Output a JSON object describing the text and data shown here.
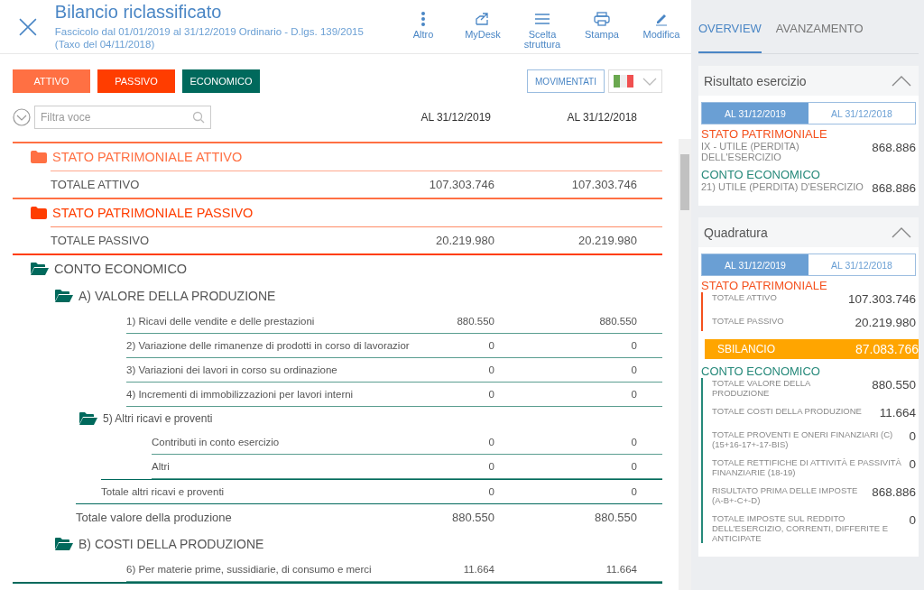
{
  "header": {
    "title": "Bilancio riclassificato",
    "subtitle": "Fascicolo dal 01/01/2019 al 31/12/2019 Ordinario - D.lgs. 139/2015 (Taxo del 04/11/2018)",
    "actions": [
      {
        "kind": "more",
        "label": "Altro"
      },
      {
        "kind": "desk",
        "label": "MyDesk"
      },
      {
        "kind": "structure",
        "label": "Scelta struttura"
      },
      {
        "kind": "print",
        "label": "Stampa"
      },
      {
        "kind": "edit",
        "label": "Modifica"
      }
    ]
  },
  "section_tabs": [
    {
      "label": "ATTIVO",
      "color": "#ff7043"
    },
    {
      "label": "PASSIVO",
      "color": "#ff3d00"
    },
    {
      "label": "ECONOMICO",
      "color": "#00695c"
    }
  ],
  "movimentati": "MOVIMENTATI",
  "filter": {
    "placeholder": "Filtra voce"
  },
  "columns": [
    "AL 31/12/2019",
    "AL 31/12/2018"
  ],
  "tree": [
    {
      "kind": "section",
      "label": "STATO PATRIMONIALE ATTIVO",
      "color": "#ff7043",
      "total": {
        "label": "TOTALE ATTIVO",
        "values": [
          "107.303.746",
          "107.303.746"
        ]
      }
    },
    {
      "kind": "section",
      "label": "STATO PATRIMONIALE PASSIVO",
      "color": "#ff3d00",
      "total": {
        "label": "TOTALE PASSIVO",
        "values": [
          "20.219.980",
          "20.219.980"
        ]
      }
    },
    {
      "kind": "group",
      "label": "CONTO ECONOMICO",
      "color": "#00695c",
      "children": [
        {
          "kind": "group",
          "label": "A) VALORE DELLA PRODUZIONE",
          "children": [
            {
              "kind": "row",
              "label": "1) Ricavi delle vendite e delle prestazioni",
              "values": [
                "880.550",
                "880.550"
              ]
            },
            {
              "kind": "row",
              "label": "2) Variazione delle rimanenze di prodotti in corso di lavorazior",
              "values": [
                "0",
                "0"
              ]
            },
            {
              "kind": "row",
              "label": "3) Variazioni dei lavori in corso su ordinazione",
              "values": [
                "0",
                "0"
              ]
            },
            {
              "kind": "row",
              "label": "4) Incrementi di immobilizzazioni per lavori interni",
              "values": [
                "0",
                "0"
              ]
            },
            {
              "kind": "group",
              "label": "5) Altri ricavi e proventi",
              "children": [
                {
                  "kind": "row",
                  "label": "Contributi in conto esercizio",
                  "values": [
                    "0",
                    "0"
                  ]
                },
                {
                  "kind": "row",
                  "label": "Altri",
                  "values": [
                    "0",
                    "0"
                  ]
                }
              ],
              "total": {
                "label": "Totale altri ricavi e proventi",
                "values": [
                  "0",
                  "0"
                ]
              }
            }
          ],
          "total": {
            "label": "Totale valore della produzione",
            "values": [
              "880.550",
              "880.550"
            ]
          }
        },
        {
          "kind": "group",
          "label": "B) COSTI DELLA PRODUZIONE",
          "children": [
            {
              "kind": "row",
              "label": "6) Per materie prime, sussidiarie, di consumo e merci",
              "values": [
                "11.664",
                "11.664"
              ]
            }
          ]
        }
      ]
    }
  ],
  "panel": {
    "tabs": [
      {
        "label": "OVERVIEW",
        "selected": true
      },
      {
        "label": "AVANZAMENTO",
        "selected": false
      }
    ],
    "cards": [
      {
        "title": "Risultato esercizio",
        "expanded": true,
        "dates": [
          {
            "label": "AL 31/12/2019",
            "selected": true
          },
          {
            "label": "AL 31/12/2018",
            "selected": false
          }
        ],
        "blocks": [
          {
            "kind": "plain",
            "title": "STATO PATRIMONIALE",
            "color": "#f4511e",
            "items": [
              {
                "label": "IX - UTILE (PERDITA) DELL'ESERCIZIO",
                "value": "868.886"
              }
            ]
          },
          {
            "kind": "plain",
            "title": "CONTO ECONOMICO",
            "color": "#26897a",
            "items": [
              {
                "label": "21) UTILE (PERDITA) D'ESERCIZIO",
                "value": "868.886"
              }
            ]
          }
        ]
      },
      {
        "title": "Quadratura",
        "expanded": true,
        "dates": [
          {
            "label": "AL 31/12/2019",
            "selected": true
          },
          {
            "label": "AL 31/12/2018",
            "selected": false
          }
        ],
        "blocks": [
          {
            "kind": "bar",
            "title": "STATO PATRIMONIALE",
            "color": "#f4511e",
            "items": [
              {
                "label": "TOTALE ATTIVO",
                "value": "107.303.746"
              },
              {
                "label": "TOTALE PASSIVO",
                "value": "20.219.980"
              }
            ]
          },
          {
            "kind": "alert",
            "label": "SBILANCIO",
            "value": "87.083.766"
          },
          {
            "kind": "bar",
            "title": "CONTO ECONOMICO",
            "color": "#26897a",
            "items": [
              {
                "label": "TOTALE VALORE DELLA PRODUZIONE",
                "value": "880.550"
              },
              {
                "label": "TOTALE COSTI DELLA PRODUZIONE",
                "value": "11.664"
              },
              {
                "label": "TOTALE PROVENTI E ONERI FINANZIARI (C) (15+16-17+-17-BIS)",
                "value": "0"
              },
              {
                "label": "TOTALE RETTIFICHE DI ATTIVITÀ E PASSIVITÀ FINANZIARIE (18-19)",
                "value": "0"
              },
              {
                "label": "RISULTATO PRIMA DELLE IMPOSTE (A-B+-C+-D)",
                "value": "868.886"
              },
              {
                "label": "TOTALE IMPOSTE SUL REDDITO DELL'ESERCIZIO, CORRENTI, DIFFERITE E ANTICIPATE",
                "value": "0"
              }
            ]
          }
        ]
      }
    ]
  }
}
